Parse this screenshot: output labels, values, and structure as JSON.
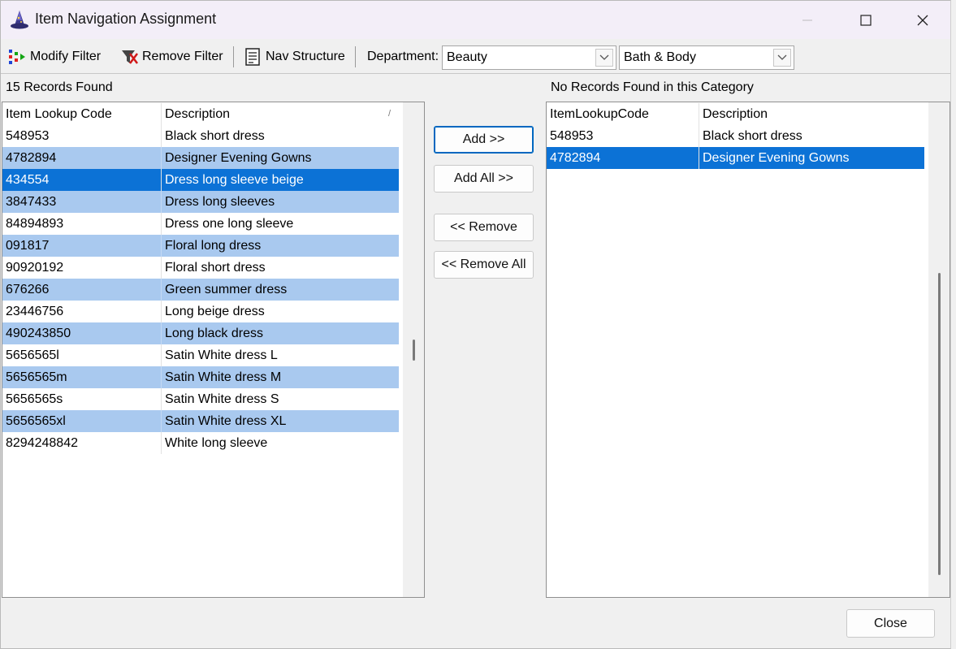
{
  "window": {
    "title": "Item Navigation Assignment",
    "minimize_label": "–",
    "maximize_label": "☐",
    "close_label": "✕"
  },
  "toolbar": {
    "modify_filter": "Modify Filter",
    "remove_filter": "Remove Filter",
    "nav_structure": "Nav Structure",
    "department_label": "Department:",
    "department_value": "Beauty",
    "category_value": "Bath & Body"
  },
  "left_panel": {
    "status": "15 Records Found",
    "columns": [
      "Item Lookup Code",
      "Description"
    ],
    "sort_glyph": "/",
    "rows": [
      {
        "code": "548953",
        "description": "Black short dress"
      },
      {
        "code": "4782894",
        "description": "Designer Evening Gowns"
      },
      {
        "code": "434554",
        "description": "Dress long sleeve beige"
      },
      {
        "code": "3847433",
        "description": "Dress long sleeves"
      },
      {
        "code": "84894893",
        "description": "Dress one long sleeve"
      },
      {
        "code": "091817",
        "description": "Floral long dress"
      },
      {
        "code": "90920192",
        "description": "Floral short dress"
      },
      {
        "code": "676266",
        "description": "Green summer dress"
      },
      {
        "code": "23446756",
        "description": "Long beige dress"
      },
      {
        "code": "490243850",
        "description": "Long black dress"
      },
      {
        "code": "5656565l",
        "description": "Satin White dress L"
      },
      {
        "code": "5656565m",
        "description": "Satin White dress M"
      },
      {
        "code": "5656565s",
        "description": "Satin White dress S"
      },
      {
        "code": "5656565xl",
        "description": "Satin White dress XL"
      },
      {
        "code": "8294248842",
        "description": "White long sleeve"
      }
    ],
    "selected_index": 2
  },
  "right_panel": {
    "status": "No Records Found in this Category",
    "columns": [
      "ItemLookupCode",
      "Description"
    ],
    "rows": [
      {
        "code": "548953",
        "description": "Black short dress"
      },
      {
        "code": "4782894",
        "description": "Designer Evening Gowns"
      }
    ],
    "selected_index": 1
  },
  "actions": {
    "add": "Add >>",
    "add_all": "Add All >>",
    "remove": "<< Remove",
    "remove_all": "<< Remove All"
  },
  "footer": {
    "close": "Close"
  },
  "colors": {
    "selected_row": "#0c72d6",
    "alt_row": "#a9c9ef",
    "title_bar": "#f3eef8",
    "default_button_border": "#0067c0"
  },
  "icons": {
    "app": "wizard-hat-icon",
    "modify_filter": "color-bars-icon",
    "remove_filter": "filter-remove-icon",
    "nav_structure": "document-list-icon"
  }
}
